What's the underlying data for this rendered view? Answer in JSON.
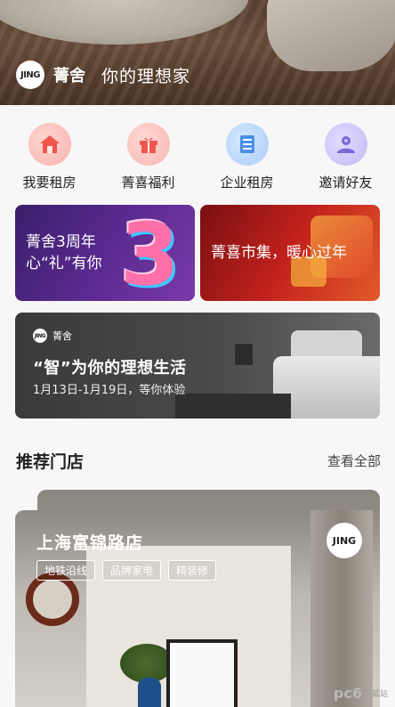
{
  "hero": {
    "logo_text": "JING",
    "brand_name": "菁舍",
    "slogan": "你的理想家"
  },
  "quick_actions": [
    {
      "label": "我要租房",
      "icon": "house-icon"
    },
    {
      "label": "菁喜福利",
      "icon": "gift-icon"
    },
    {
      "label": "企业租房",
      "icon": "building-icon"
    },
    {
      "label": "邀请好友",
      "icon": "invite-friend-icon"
    }
  ],
  "promos": [
    {
      "line1": "菁舍3周年",
      "line2": "心“礼”有你",
      "big": "3"
    },
    {
      "line1": "菁喜市集，暖心过年"
    }
  ],
  "smart_banner": {
    "logo_text": "JING",
    "brand_name": "菁舍",
    "title": "“智”为你的理想生活",
    "subtitle": "1月13日-1月19日，等你体验"
  },
  "stores_section": {
    "title": "推荐门店",
    "more_label": "查看全部"
  },
  "store_card": {
    "name": "上海富锦路店",
    "logo_text": "JING",
    "tags": [
      "地铁沿线",
      "品牌家电",
      "精装修"
    ]
  },
  "watermark": {
    "text": "pc6",
    "sub": "下载站"
  },
  "colors": {
    "accent_red": "#f0564a",
    "accent_blue": "#4a8fe8",
    "accent_purple": "#7a68d8"
  }
}
